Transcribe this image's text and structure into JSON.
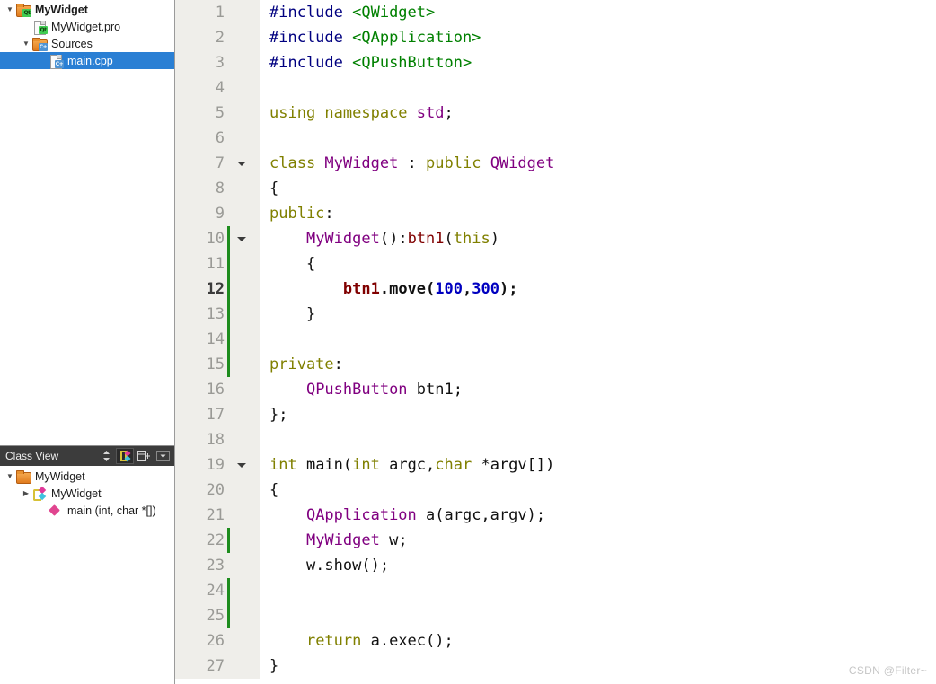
{
  "project_tree": {
    "name": "project-tree",
    "rows": [
      {
        "label": "MyWidget",
        "indent": 0,
        "twisty": "down",
        "icon": "folder-qt-icon",
        "bold": true,
        "selected": false
      },
      {
        "label": "MyWidget.pro",
        "indent": 1,
        "twisty": "none",
        "icon": "file-qt-icon",
        "bold": false,
        "selected": false
      },
      {
        "label": "Sources",
        "indent": 1,
        "twisty": "down",
        "icon": "folder-cpp-icon",
        "bold": false,
        "selected": false
      },
      {
        "label": "main.cpp",
        "indent": 2,
        "twisty": "none",
        "icon": "file-cpp-icon",
        "bold": false,
        "selected": true
      }
    ]
  },
  "class_view": {
    "title": "Class View",
    "toolbar": [
      {
        "name": "sort-toggle-button",
        "icon": "sort-arrows-icon",
        "active": false
      },
      {
        "name": "sync-selection-button",
        "icon": "sync-nodes-icon",
        "active": true
      },
      {
        "name": "expand-all-button",
        "icon": "expand-all-icon",
        "active": false
      },
      {
        "name": "filter-menu-button",
        "icon": "chevron-down-icon",
        "active": false
      }
    ],
    "rows": [
      {
        "label": "MyWidget",
        "indent": 0,
        "twisty": "down",
        "icon": "folder-icon"
      },
      {
        "label": "MyWidget",
        "indent": 1,
        "twisty": "right",
        "icon": "class-icon"
      },
      {
        "label": "main (int, char *[])",
        "indent": 2,
        "twisty": "none",
        "icon": "function-icon"
      }
    ]
  },
  "editor": {
    "name": "code-editor",
    "current_line": 12,
    "lines": [
      {
        "n": 1,
        "changed": false,
        "fold": false,
        "tokens": [
          {
            "t": "#include ",
            "c": "pre"
          },
          {
            "t": "<QWidget>",
            "c": "str"
          }
        ]
      },
      {
        "n": 2,
        "changed": false,
        "fold": false,
        "tokens": [
          {
            "t": "#include ",
            "c": "pre"
          },
          {
            "t": "<QApplication>",
            "c": "str"
          }
        ]
      },
      {
        "n": 3,
        "changed": false,
        "fold": false,
        "tokens": [
          {
            "t": "#include ",
            "c": "pre"
          },
          {
            "t": "<QPushButton>",
            "c": "str"
          }
        ]
      },
      {
        "n": 4,
        "changed": false,
        "fold": false,
        "tokens": []
      },
      {
        "n": 5,
        "changed": false,
        "fold": false,
        "tokens": [
          {
            "t": "using namespace ",
            "c": "kw"
          },
          {
            "t": "std",
            "c": "cls"
          },
          {
            "t": ";",
            "c": "plain"
          }
        ]
      },
      {
        "n": 6,
        "changed": false,
        "fold": false,
        "tokens": []
      },
      {
        "n": 7,
        "changed": false,
        "fold": true,
        "tokens": [
          {
            "t": "class ",
            "c": "kw"
          },
          {
            "t": "MyWidget",
            "c": "cls"
          },
          {
            "t": " : ",
            "c": "plain"
          },
          {
            "t": "public ",
            "c": "kw"
          },
          {
            "t": "QWidget",
            "c": "cls"
          }
        ]
      },
      {
        "n": 8,
        "changed": false,
        "fold": false,
        "tokens": [
          {
            "t": "{",
            "c": "plain"
          }
        ]
      },
      {
        "n": 9,
        "changed": false,
        "fold": false,
        "tokens": [
          {
            "t": "public",
            "c": "kw"
          },
          {
            "t": ":",
            "c": "plain"
          }
        ]
      },
      {
        "n": 10,
        "changed": true,
        "fold": true,
        "tokens": [
          {
            "t": "    ",
            "c": "plain"
          },
          {
            "t": "MyWidget",
            "c": "cls"
          },
          {
            "t": "():",
            "c": "plain"
          },
          {
            "t": "btn1",
            "c": "fld"
          },
          {
            "t": "(",
            "c": "plain"
          },
          {
            "t": "this",
            "c": "kw"
          },
          {
            "t": ")",
            "c": "plain"
          }
        ]
      },
      {
        "n": 11,
        "changed": true,
        "fold": false,
        "tokens": [
          {
            "t": "    {",
            "c": "plain"
          }
        ]
      },
      {
        "n": 12,
        "changed": true,
        "fold": false,
        "tokens": [
          {
            "t": "        ",
            "c": "plain"
          },
          {
            "t": "btn1",
            "c": "fld"
          },
          {
            "t": ".move(",
            "c": "plain"
          },
          {
            "t": "100",
            "c": "num"
          },
          {
            "t": ",",
            "c": "plain"
          },
          {
            "t": "300",
            "c": "num"
          },
          {
            "t": ");",
            "c": "plain"
          }
        ]
      },
      {
        "n": 13,
        "changed": true,
        "fold": false,
        "tokens": [
          {
            "t": "    }",
            "c": "plain"
          }
        ]
      },
      {
        "n": 14,
        "changed": true,
        "fold": false,
        "tokens": []
      },
      {
        "n": 15,
        "changed": true,
        "fold": false,
        "tokens": [
          {
            "t": "private",
            "c": "kw"
          },
          {
            "t": ":",
            "c": "plain"
          }
        ]
      },
      {
        "n": 16,
        "changed": false,
        "fold": false,
        "tokens": [
          {
            "t": "    ",
            "c": "plain"
          },
          {
            "t": "QPushButton",
            "c": "cls"
          },
          {
            "t": " btn1;",
            "c": "plain"
          }
        ]
      },
      {
        "n": 17,
        "changed": false,
        "fold": false,
        "tokens": [
          {
            "t": "};",
            "c": "plain"
          }
        ]
      },
      {
        "n": 18,
        "changed": false,
        "fold": false,
        "tokens": []
      },
      {
        "n": 19,
        "changed": false,
        "fold": true,
        "tokens": [
          {
            "t": "int ",
            "c": "kw"
          },
          {
            "t": "main(",
            "c": "plain"
          },
          {
            "t": "int ",
            "c": "kw"
          },
          {
            "t": "argc,",
            "c": "plain"
          },
          {
            "t": "char ",
            "c": "kw"
          },
          {
            "t": "*argv[])",
            "c": "plain"
          }
        ]
      },
      {
        "n": 20,
        "changed": false,
        "fold": false,
        "tokens": [
          {
            "t": "{",
            "c": "plain"
          }
        ]
      },
      {
        "n": 21,
        "changed": false,
        "fold": false,
        "tokens": [
          {
            "t": "    ",
            "c": "plain"
          },
          {
            "t": "QApplication",
            "c": "cls"
          },
          {
            "t": " a(argc,argv);",
            "c": "plain"
          }
        ]
      },
      {
        "n": 22,
        "changed": true,
        "fold": false,
        "tokens": [
          {
            "t": "    ",
            "c": "plain"
          },
          {
            "t": "MyWidget",
            "c": "cls"
          },
          {
            "t": " w;",
            "c": "plain"
          }
        ]
      },
      {
        "n": 23,
        "changed": false,
        "fold": false,
        "tokens": [
          {
            "t": "    w.show();",
            "c": "plain"
          }
        ]
      },
      {
        "n": 24,
        "changed": true,
        "fold": false,
        "tokens": []
      },
      {
        "n": 25,
        "changed": true,
        "fold": false,
        "tokens": []
      },
      {
        "n": 26,
        "changed": false,
        "fold": false,
        "tokens": [
          {
            "t": "    ",
            "c": "plain"
          },
          {
            "t": "return ",
            "c": "kw"
          },
          {
            "t": "a.exec();",
            "c": "plain"
          }
        ]
      },
      {
        "n": 27,
        "changed": false,
        "fold": false,
        "tokens": [
          {
            "t": "}",
            "c": "plain"
          }
        ]
      }
    ]
  },
  "watermark": {
    "text": "CSDN @Filter~"
  },
  "colors": {
    "selection": "#2a7fd4",
    "gutter_bg": "#efeeea",
    "change_bar": "#1d8c1d",
    "dock_header_bg": "#3c3c3c",
    "preprocessor": "#000080",
    "string": "#008000",
    "keyword": "#808000",
    "type": "#800080",
    "field": "#800000",
    "number": "#0000c0"
  }
}
